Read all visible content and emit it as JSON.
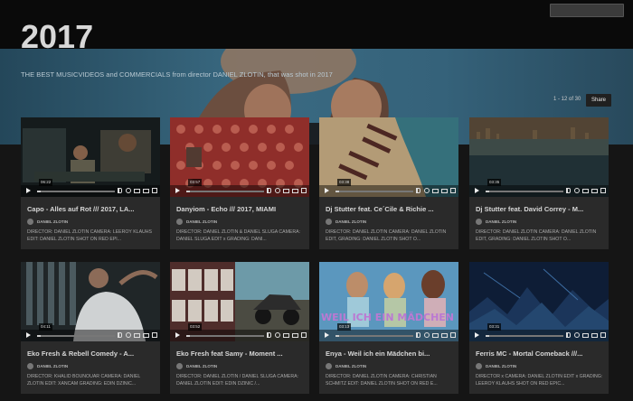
{
  "header": {
    "search_placeholder": ""
  },
  "page": {
    "title": "2017",
    "description": "THE BEST MUSICVIDEOS and COMMERCIALS from director DANIEL ZLOTIN, that was shot in 2017",
    "pager": "1 - 12 of 30",
    "share_label": "Share"
  },
  "colors": {
    "hero_bg": "#2f5b71",
    "page_bg": "#0b0b0b",
    "card_bg": "#2a2a2a"
  },
  "videos": [
    {
      "title": "Capo - Alles auf Rot /// 2017, LA...",
      "author": "DANIEL ZLOTIN",
      "description": "DIRECTOR: DANIEL ZLOTIN CAMERA: LEEROY KLAUHS EDIT: DANIEL ZLOTIN SHOT ON RED EPI...",
      "duration": "06:22"
    },
    {
      "title": "Danyiom - Echo /// 2017, MIAMI",
      "author": "DANIEL ZLOTIN",
      "description": "DIRECTOR: DANIEL ZLOTIN & DANIEL SLUGA CAMERA: DANIEL SLUGA EDIT x GRADING: DANI...",
      "duration": "03:57"
    },
    {
      "title": "Dj Stutter feat. Ce´Cile & Richie ...",
      "author": "DANIEL ZLOTIN",
      "description": "DIRECTOR: DANIEL ZLOTIN CAMERA: DANIEL ZLOTIN EDIT, GRADING: DANIEL ZLOTIN SHOT O...",
      "duration": "03:38"
    },
    {
      "title": "Dj Stutter feat. David Correy - M...",
      "author": "DANIEL ZLOTIN",
      "description": "DIRECTOR: DANIEL ZLOTIN CAMERA: DANIEL ZLOTIN EDIT, GRADING: DANIEL ZLOTIN SHOT O...",
      "duration": "03:35"
    },
    {
      "title": "Eko Fresh & Rebell Comedy - A...",
      "author": "DANIEL ZLOTIN",
      "description": "DIRECTOR: KHALID BOUNOUAR CAMERA: DANIEL ZLOTIN EDIT: XANCAM GRADING: EDIN DZINIC...",
      "duration": "04:11"
    },
    {
      "title": "Eko Fresh feat Samy - Moment ...",
      "author": "DANIEL ZLOTIN",
      "description": "DIRECTOR: DANIEL ZLOTIN / DANIEL SLUGA CAMERA: DANIEL ZLOTIN EDIT: EDIN DZINIC /...",
      "duration": "03:52"
    },
    {
      "title": "Enya - Weil ich ein Mädchen bi...",
      "author": "DANIEL ZLOTIN",
      "description": "DIRECTOR: DANIEL ZLOTIN CAMERA: CHRISTIAN SCHMITZ EDIT: DANIEL ZLOTIN SHOT ON RED E...",
      "duration": "03:13"
    },
    {
      "title": "Ferris MC - Mortal Comeback ///...",
      "author": "DANIEL ZLOTIN",
      "description": "DIRECTOR x CAMERA: DANIEL ZLOTIN EDIT x GRADING: LEEROY KLAUHS SHOT ON RED EPIC...",
      "duration": "03:31"
    }
  ]
}
